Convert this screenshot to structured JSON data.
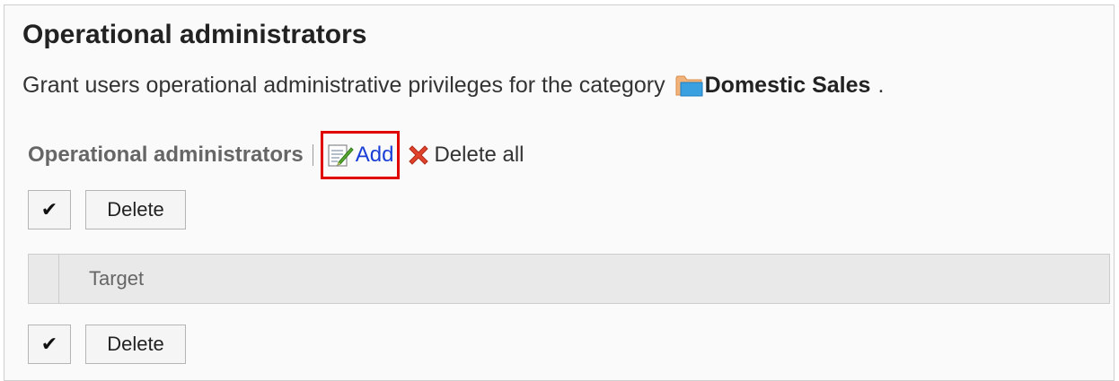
{
  "title": "Operational administrators",
  "description": {
    "text": "Grant users operational administrative privileges for the category",
    "category_icon": "folder-icon",
    "category_name": "Domestic Sales",
    "suffix": "."
  },
  "toolbar": {
    "section_label": "Operational administrators",
    "add_label": "Add",
    "add_icon": "edit-note-icon",
    "delete_all_label": "Delete all",
    "delete_all_icon": "red-x-icon",
    "highlight_color": "#e00000",
    "link_color": "#1a3fd6"
  },
  "actions": {
    "check_glyph": "✔",
    "delete_label": "Delete"
  },
  "table": {
    "columns": [
      "Target"
    ]
  }
}
